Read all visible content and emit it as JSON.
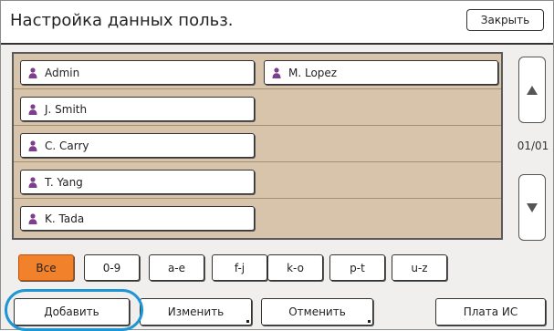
{
  "header": {
    "title": "Настройка данных польз.",
    "close_label": "Закрыть"
  },
  "users": [
    {
      "name": "Admin",
      "icon": "user-icon"
    },
    {
      "name": "M. Lopez",
      "icon": "user-icon"
    },
    {
      "name": "J. Smith",
      "icon": "user-icon"
    },
    {
      "name": "C. Carry",
      "icon": "user-icon"
    },
    {
      "name": "T. Yang",
      "icon": "user-icon"
    },
    {
      "name": "K. Tada",
      "icon": "user-icon"
    }
  ],
  "pager": {
    "counter": "01/01",
    "up_icon": "arrow-up-icon",
    "down_icon": "arrow-down-icon"
  },
  "filters": [
    "Все",
    "0-9",
    "a-e",
    "f-j",
    "k-o",
    "p-t",
    "u-z"
  ],
  "active_filter": "Все",
  "actions": {
    "add": "Добавить",
    "edit": "Изменить",
    "cancel": "Отменить",
    "ic_card": "Плата ИС"
  },
  "colors": {
    "list_bg": "#d7c4ab",
    "active_filter": "#f2812b",
    "user_icon": "#7b3f8c",
    "highlight": "#1e95d4"
  }
}
